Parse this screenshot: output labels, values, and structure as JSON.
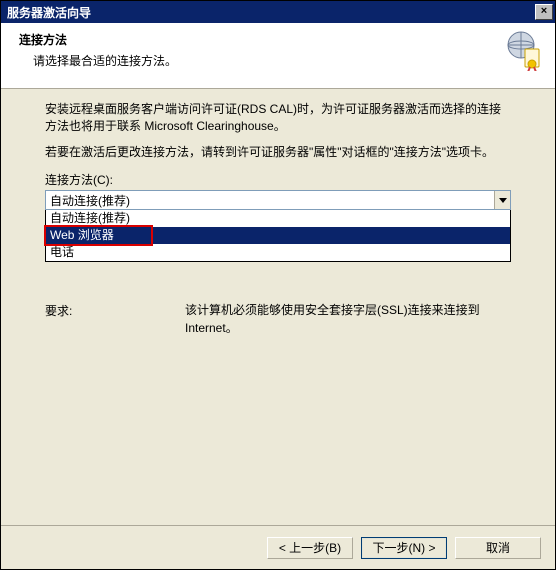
{
  "window": {
    "title": "服务器激活向导"
  },
  "header": {
    "title": "连接方法",
    "subtitle": "请选择最合适的连接方法。"
  },
  "body": {
    "p1": "安装远程桌面服务客户端访问许可证(RDS CAL)时，为许可证服务器激活而选择的连接方法也将用于联系 Microsoft Clearinghouse。",
    "p2": "若要在激活后更改连接方法，请转到许可证服务器\"属性\"对话框的\"连接方法\"选项卡。",
    "combo_label": "连接方法(C):",
    "combo_value": "自动连接(推荐)",
    "options": {
      "o0": "自动连接(推荐)",
      "o1": "Web 浏览器",
      "o2": "电话"
    },
    "req_label": "要求:",
    "req_text": "该计算机必须能够使用安全套接字层(SSL)连接来连接到 Internet。"
  },
  "footer": {
    "back": "< 上一步(B)",
    "next": "下一步(N) >",
    "cancel": "取消"
  }
}
